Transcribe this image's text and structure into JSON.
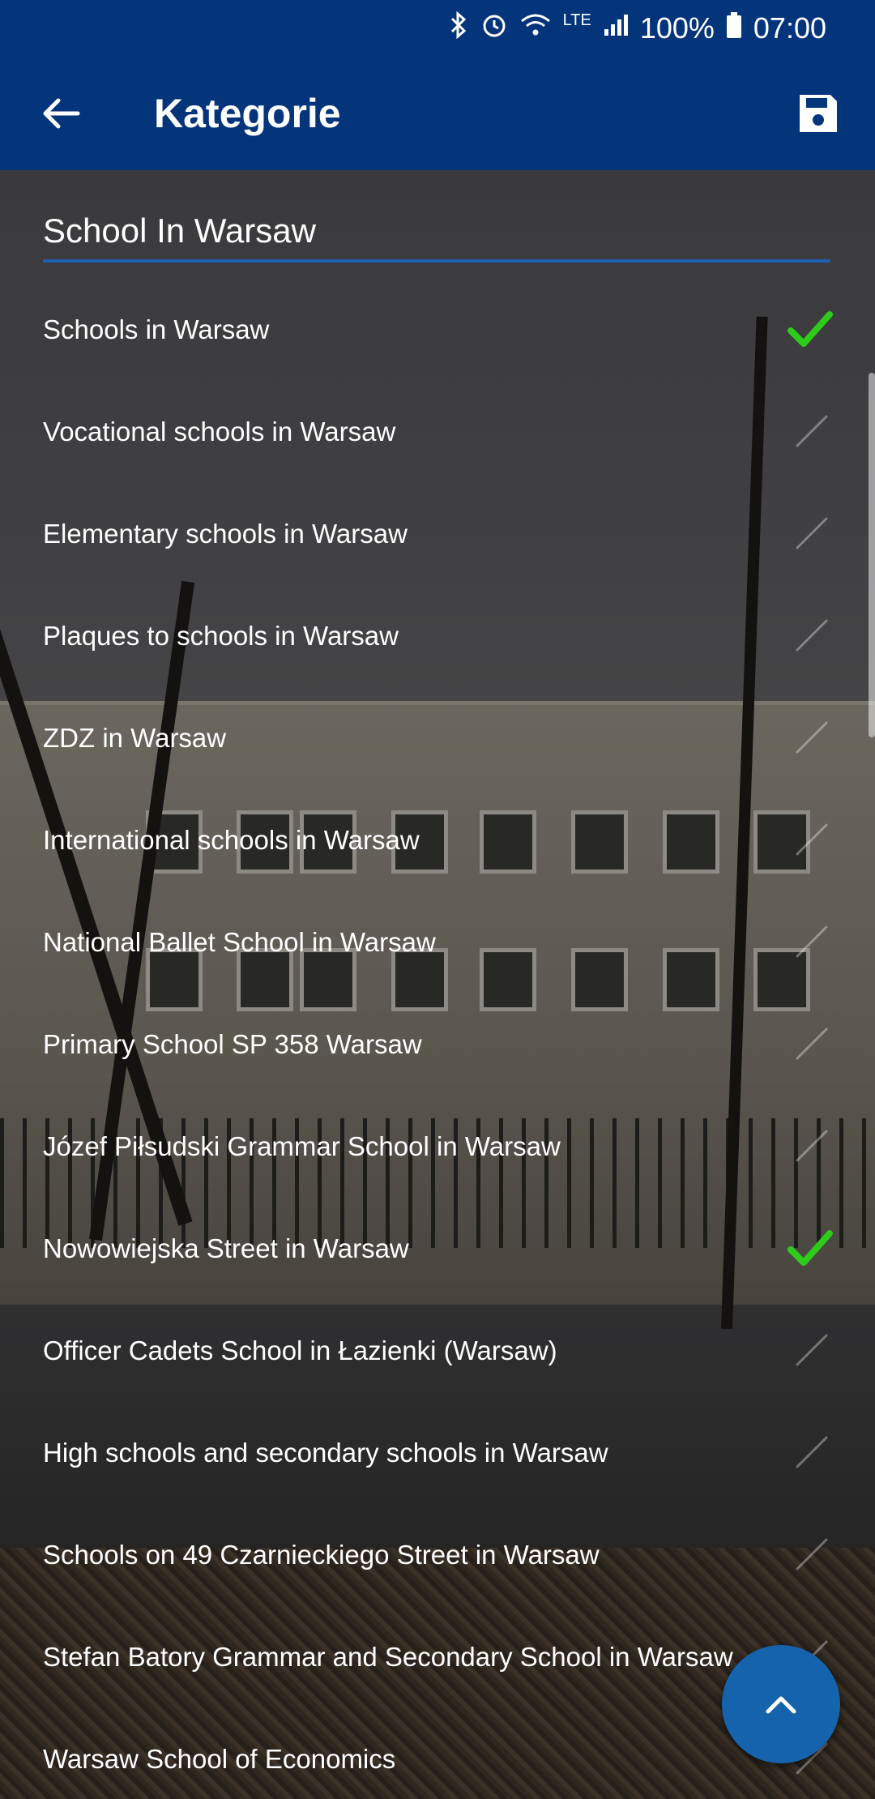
{
  "status_bar": {
    "battery": "100%",
    "time": "07:00",
    "network": "LTE"
  },
  "app_bar": {
    "title": "Kategorie",
    "back_icon": "arrow-left-icon",
    "save_icon": "floppy-disk-icon"
  },
  "search": {
    "value": "School In Warsaw"
  },
  "categories": [
    {
      "label": "Schools in Warsaw",
      "selected": true
    },
    {
      "label": "Vocational schools in Warsaw",
      "selected": false
    },
    {
      "label": "Elementary schools in Warsaw",
      "selected": false
    },
    {
      "label": "Plaques to schools in Warsaw",
      "selected": false
    },
    {
      "label": "ZDZ in Warsaw",
      "selected": false
    },
    {
      "label": "International schools in Warsaw",
      "selected": false
    },
    {
      "label": "National Ballet School in Warsaw",
      "selected": false
    },
    {
      "label": "Primary School SP 358 Warsaw",
      "selected": false
    },
    {
      "label": "Józef Piłsudski Grammar School in Warsaw",
      "selected": false
    },
    {
      "label": "Nowowiejska Street in Warsaw",
      "selected": true
    },
    {
      "label": "Officer Cadets School in Łazienki (Warsaw)",
      "selected": false
    },
    {
      "label": "High schools and secondary schools in Warsaw",
      "selected": false
    },
    {
      "label": "Schools on 49 Czarnieckiego Street in Warsaw",
      "selected": false
    },
    {
      "label": "Stefan Batory Grammar and Secondary School in Warsaw",
      "selected": false
    },
    {
      "label": "Warsaw School of Economics",
      "selected": false
    }
  ],
  "colors": {
    "app_bar": "#04347a",
    "accent": "#1d5fb5",
    "check_selected": "#2ecc1a",
    "fab": "#1563ad"
  },
  "fab": {
    "icon": "chevron-up-icon"
  }
}
